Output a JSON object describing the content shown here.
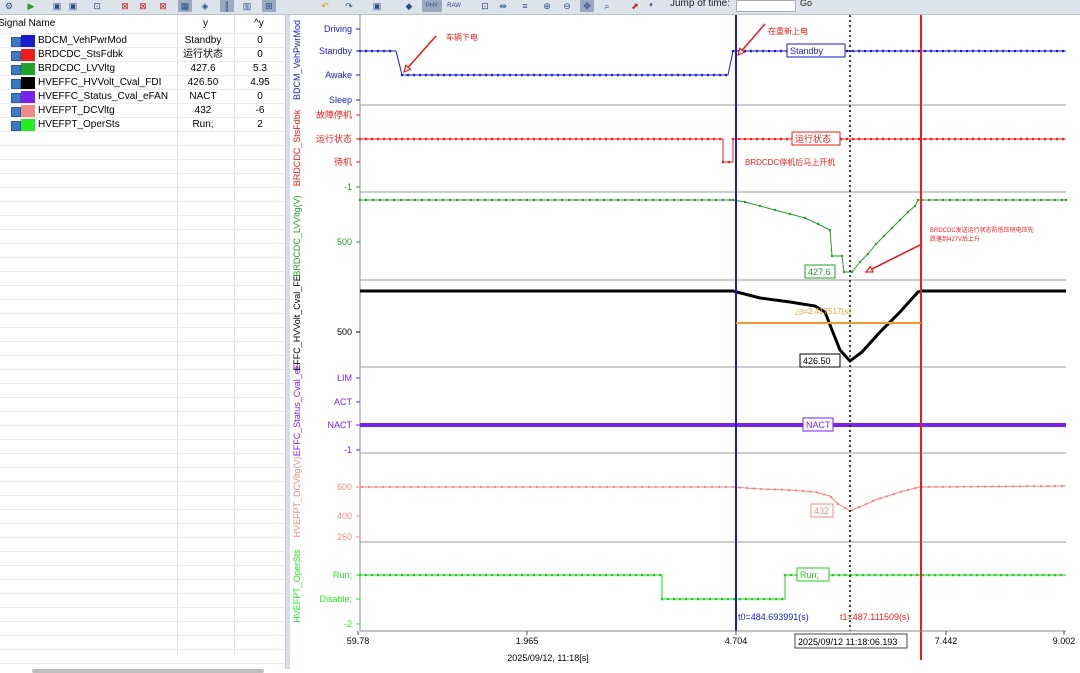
{
  "toolbar": {
    "jump_label": "Jump of time:",
    "go_label": "Go",
    "phy_label": "PHY",
    "raw_label": "RAW"
  },
  "table": {
    "header_name": "Signal Name",
    "header_y": "y",
    "header_dy": "^y",
    "rows": [
      {
        "name": "BDCM_VehPwrMod",
        "y": "Standby",
        "dy": "0",
        "color": "#1a1acc"
      },
      {
        "name": "BRDCDC_StsFdbk",
        "y": "运行状态",
        "dy": "0",
        "color": "#ee1c1c"
      },
      {
        "name": "BRDCDC_LVVltg",
        "y": "427.6",
        "dy": "5.3",
        "color": "#22a02a"
      },
      {
        "name": "HVEFFC_HVVolt_Cval_FDI",
        "y": "426.50",
        "dy": "4.95",
        "color": "#000000"
      },
      {
        "name": "HVEFFC_Status_Cval_eFAN",
        "y": "NACT",
        "dy": "0",
        "color": "#7a22ee"
      },
      {
        "name": "HVEFPT_DCVltg",
        "y": "432",
        "dy": "-6",
        "color": "#f08a8a"
      },
      {
        "name": "HVEFPT_OperSts",
        "y": "Run;",
        "dy": "2",
        "color": "#22ee22"
      }
    ]
  },
  "lanes": [
    {
      "title": "BDCM_VehPwrMod",
      "color": "#1a1acc",
      "ticks": [
        "Driving",
        "Standby",
        "Awake",
        "Sleep"
      ]
    },
    {
      "title": "BRDCDC_StsFdbk",
      "color": "#ee1c1c",
      "ticks": [
        "故障停机",
        "运行状态",
        "待机"
      ]
    },
    {
      "title": "BRDCDC_LVVltg(V)",
      "color": "#22a02a",
      "ticks": [
        "-1",
        "500"
      ]
    },
    {
      "title": "EFFC_HVVolt_Cval_FE",
      "color": "#000000",
      "ticks": [
        "500"
      ]
    },
    {
      "title": "EFFC_Status_Cval_eF",
      "color": "#7a22ee",
      "ticks": [
        "LIM",
        "ACT",
        "NACT",
        "-1"
      ]
    },
    {
      "title": "HVEFPT_DCVltg(V)",
      "color": "#f08a8a",
      "ticks": [
        "600",
        "400",
        "260"
      ]
    },
    {
      "title": "HVEFPT_OperSts",
      "color": "#22ee22",
      "ticks": [
        "Run;",
        "Disable;",
        "-2"
      ]
    }
  ],
  "annotations": {
    "a1": "车辆下电",
    "a2": "在重新上电",
    "a3": "BRDCDC停机后马上开机",
    "a4_line1": "BRDCDC发送运行状态防低压侧电压先",
    "a4_line2": "跌落到427V后上升"
  },
  "value_labels": {
    "standby": "Standby",
    "run_state": "运行状态",
    "lv": "427.6",
    "hv": "426.50",
    "delta": "△t=2.417517(s)",
    "nact": "NACT",
    "dcv": "432",
    "run": "Run;"
  },
  "cursors": {
    "t0": "t0=484.693991(s)",
    "t1": "t1=487.111509(s)",
    "hover": "2025/09/12 11:18:06.193"
  },
  "time_axis": {
    "ticks": [
      "59.78",
      "1.965",
      "4.704",
      "7.442",
      "9.002"
    ],
    "label": "2025/09/12, 11:18[s]"
  }
}
